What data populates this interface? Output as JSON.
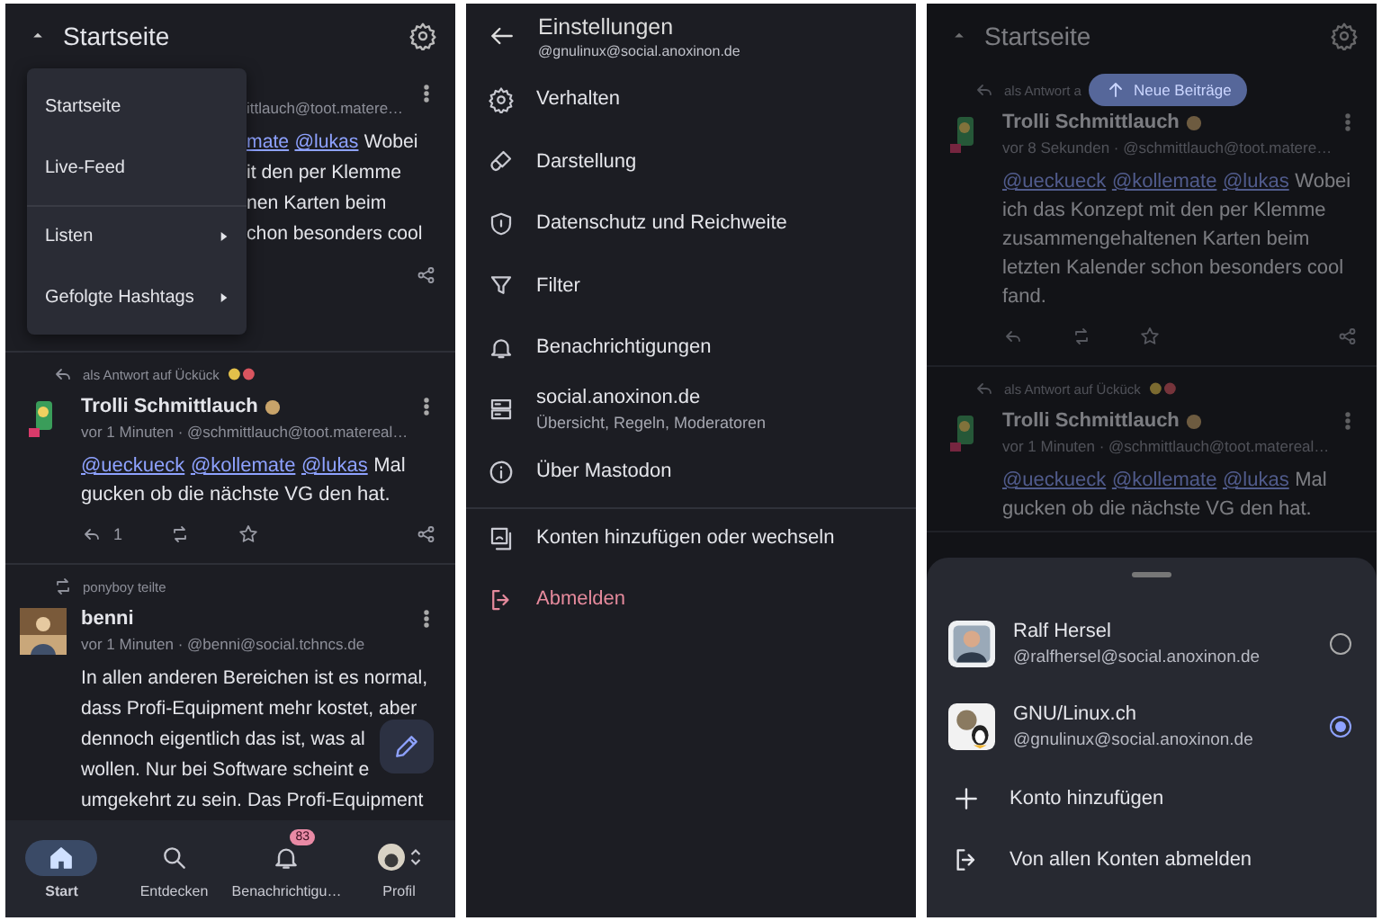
{
  "screens": [
    {
      "kind": "timeline",
      "dimmed": false,
      "header": {
        "title": "Startseite"
      },
      "menu": {
        "items": [
          {
            "label": "Startseite",
            "submenu": false,
            "divider_before": false
          },
          {
            "label": "Live-Feed",
            "submenu": false,
            "divider_before": false
          },
          {
            "label": "Listen",
            "submenu": true,
            "divider_before": true
          },
          {
            "label": "Gefolgte Hashtags",
            "submenu": true,
            "divider_before": false
          }
        ]
      },
      "posts": [
        {
          "covered": true,
          "meta": "ittlauch@toot.matere…",
          "lines": [
            {
              "mentions": [
                "mate",
                "@lukas"
              ],
              "text": "Wobei"
            },
            {
              "text": "it den per Klemme"
            },
            {
              "text": "nen Karten beim"
            },
            {
              "text": "chon besonders cool"
            }
          ],
          "action_row": {
            "kind": "share_only"
          }
        },
        {
          "context": {
            "kind": "reply",
            "text": "als Antwort auf Ückück",
            "emoji": true
          },
          "avatar": {
            "kind": "sticker"
          },
          "author": "Trolli Schmittlauch",
          "author_emoji": true,
          "meta": "vor 1 Minuten · @schmittlauch@toot.matereal…",
          "mentions": [
            "@ueckueck",
            "@kollemate",
            "@lukas"
          ],
          "text": "Mal gucken ob die nächste VG den hat.",
          "action_row": {
            "kind": "full"
          },
          "reply_count": "1"
        },
        {
          "context": {
            "kind": "boost",
            "text": "ponyboy teilte",
            "emoji": false
          },
          "author": "benni",
          "author_emoji": false,
          "meta": "vor 1 Minuten · @benni@social.tchncs.de",
          "lines": [
            {
              "text": "In allen anderen Bereichen ist es normal,"
            },
            {
              "text": "dass Profi-Equipment mehr kostet, aber"
            },
            {
              "text": "dennoch eigentlich das ist, was al"
            },
            {
              "text": "wollen. Nur bei Software scheint e"
            },
            {
              "text": "umgekehrt zu sein. Das Profi-Equipment"
            }
          ]
        }
      ],
      "fab": true,
      "nav": [
        {
          "label": "Start",
          "selected": true
        },
        {
          "label": "Entdecken",
          "selected": false
        },
        {
          "label": "Benachrichtigu…",
          "selected": false,
          "badge": "83"
        },
        {
          "label": "Profil",
          "selected": false
        }
      ]
    },
    {
      "kind": "settings",
      "title": "Einstellungen",
      "account": "@gnulinux@social.anoxinon.de",
      "items": [
        {
          "label": "Verhalten",
          "kind": "normal",
          "divider_before": false
        },
        {
          "label": "Darstellung",
          "kind": "normal",
          "divider_before": false
        },
        {
          "label": "Datenschutz und Reichweite",
          "kind": "normal",
          "divider_before": false
        },
        {
          "label": "Filter",
          "kind": "normal",
          "divider_before": false
        },
        {
          "label": "Benachrichtigungen",
          "kind": "normal",
          "divider_before": false
        },
        {
          "label": "social.anoxinon.de",
          "sublabel": "Übersicht, Regeln, Moderatoren",
          "kind": "normal",
          "divider_before": false
        },
        {
          "label": "Über Mastodon",
          "kind": "normal",
          "divider_before": false
        },
        {
          "label": "Konten hinzufügen oder wechseln",
          "kind": "normal",
          "divider_before": true
        },
        {
          "label": "Abmelden",
          "kind": "danger",
          "divider_before": false
        }
      ]
    },
    {
      "kind": "timeline",
      "dimmed": true,
      "header": {
        "title": "Startseite"
      },
      "new_posts_pill": "Neue Beiträge",
      "posts": [
        {
          "context": {
            "kind": "reply",
            "text": "als Antwort a"
          },
          "avatar": {
            "kind": "sticker"
          },
          "author": "Trolli Schmittlauch",
          "author_emoji": true,
          "meta": "vor 8 Sekunden · @schmittlauch@toot.matere…",
          "mentions": [
            "@ueckueck",
            "@kollemate",
            "@lukas"
          ],
          "text": "Wobei ich das Konzept mit den per Klemme zusammengehaltenen Karten beim letzten Kalender schon besonders cool fand.",
          "action_row": {
            "kind": "full"
          }
        },
        {
          "context": {
            "kind": "reply",
            "text": "als Antwort auf Ückück",
            "emoji": true
          },
          "avatar": {
            "kind": "sticker"
          },
          "author": "Trolli Schmittlauch",
          "author_emoji": true,
          "meta": "vor 1 Minuten · @schmittlauch@toot.matereal…",
          "mentions": [
            "@ueckueck",
            "@kollemate",
            "@lukas"
          ],
          "text": "Mal gucken ob die nächste VG den hat."
        }
      ],
      "sheet": {
        "accounts": [
          {
            "name": "Ralf Hersel",
            "handle": "@ralfhersel@social.anoxinon.de",
            "avatar": {
              "kind": "person"
            },
            "selected": false
          },
          {
            "name": "GNU/Linux.ch",
            "handle": "@gnulinux@social.anoxinon.de",
            "avatar": {
              "kind": "mascot"
            },
            "selected": true
          }
        ],
        "actions": [
          {
            "label": "Konto hinzufügen",
            "kind": "add"
          },
          {
            "label": "Von allen Konten abmelden",
            "kind": "logout"
          }
        ]
      }
    }
  ]
}
